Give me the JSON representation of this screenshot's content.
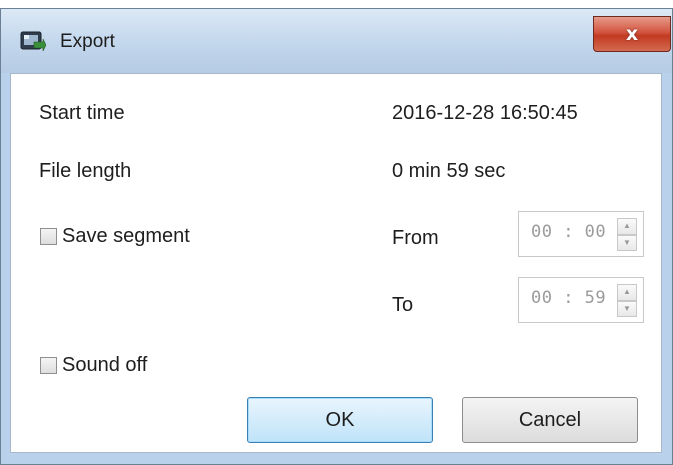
{
  "window": {
    "title": "Export",
    "close_symbol": "x",
    "icon": "export-window-icon"
  },
  "fields": {
    "start_time_label": "Start time",
    "start_time_value": "2016-12-28 16:50:45",
    "file_length_label": "File length",
    "file_length_value": "0 min 59 sec"
  },
  "options": {
    "save_segment_label": "Save segment",
    "save_segment_checked": false,
    "sound_off_label": "Sound off",
    "sound_off_checked": false
  },
  "segment": {
    "from_label": "From",
    "from_value": "00 : 00",
    "to_label": "To",
    "to_value": "00 : 59",
    "enabled": false
  },
  "buttons": {
    "ok_label": "OK",
    "cancel_label": "Cancel"
  },
  "colors": {
    "titlebar": "#c2d6ec",
    "close_button": "#c23a22",
    "ok_border": "#3c7fb1"
  }
}
